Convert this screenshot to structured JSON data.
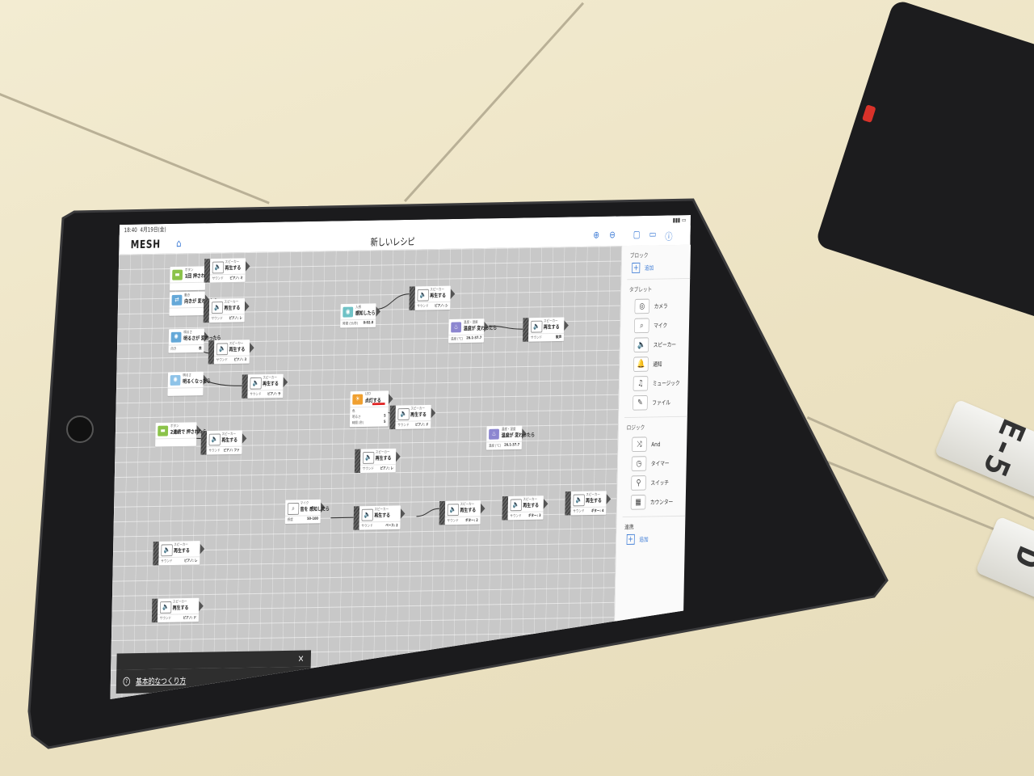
{
  "status": {
    "time": "18:40",
    "date": "4月19日(金)"
  },
  "nav": {
    "logo": "MESH",
    "title": "新しいレシピ"
  },
  "sidebar": {
    "block_title": "ブロック",
    "add_label": "追加",
    "tablet_title": "タブレット",
    "tablet_items": [
      {
        "label": "カメラ",
        "icon": "camera-icon",
        "glyph": "◎"
      },
      {
        "label": "マイク",
        "icon": "microphone-icon",
        "glyph": "⌕"
      },
      {
        "label": "スピーカー",
        "icon": "speaker-icon",
        "glyph": "🔈"
      },
      {
        "label": "通知",
        "icon": "bell-icon",
        "glyph": "🔔"
      },
      {
        "label": "ミュージック",
        "icon": "music-icon",
        "glyph": "♫"
      },
      {
        "label": "ファイル",
        "icon": "file-icon",
        "glyph": "✎"
      }
    ],
    "logic_title": "ロジック",
    "logic_items": [
      {
        "label": "And",
        "icon": "and-icon",
        "glyph": "⤨"
      },
      {
        "label": "タイマー",
        "icon": "timer-icon",
        "glyph": "◷"
      },
      {
        "label": "スイッチ",
        "icon": "switch-icon",
        "glyph": "⚲"
      },
      {
        "label": "カウンター",
        "icon": "counter-icon",
        "glyph": "▦"
      }
    ],
    "outer_title": "連携",
    "outer_add_label": "追加"
  },
  "blocks": [
    {
      "id": "b1",
      "kind": "ボタン",
      "action": "1回\n押されたら",
      "p1": "",
      "p2": "",
      "color": "green",
      "glyph": "▬"
    },
    {
      "id": "b2",
      "kind": "スピーカー",
      "action": "再生する",
      "p1": "サウンド",
      "p2": "ピアノ: ミ",
      "color": "spk",
      "glyph": "🔈"
    },
    {
      "id": "b3",
      "kind": "動き",
      "action": "向きが\n変わったら",
      "p1": "",
      "p2": "",
      "color": "blue",
      "glyph": "⇄"
    },
    {
      "id": "b4",
      "kind": "スピーカー",
      "action": "再生する",
      "p1": "サウンド",
      "p2": "ピアノ: レ",
      "color": "spk",
      "glyph": "🔈"
    },
    {
      "id": "b5",
      "kind": "明るさ",
      "action": "明るさが\n変わったら",
      "p1": "向き",
      "p2": "表",
      "color": "blue",
      "glyph": "✺"
    },
    {
      "id": "b6",
      "kind": "スピーカー",
      "action": "再生する",
      "p1": "サウンド",
      "p2": "ピアノ: ミ",
      "color": "spk",
      "glyph": "🔈"
    },
    {
      "id": "b7",
      "kind": "明るさ",
      "action": "明るくなったら",
      "p1": "",
      "p2": "",
      "color": "lblue",
      "glyph": "✺"
    },
    {
      "id": "b8",
      "kind": "スピーカー",
      "action": "再生する",
      "p1": "サウンド",
      "p2": "ピアノ: ラ",
      "color": "spk",
      "glyph": "🔈"
    },
    {
      "id": "b9",
      "kind": "ボタン",
      "action": "2連続で\n押されたら",
      "p1": "",
      "p2": "",
      "color": "green",
      "glyph": "▬"
    },
    {
      "id": "b10",
      "kind": "スピーカー",
      "action": "再生する",
      "p1": "サウンド",
      "p2": "ピアノ: ファ",
      "color": "spk",
      "glyph": "🔈"
    },
    {
      "id": "b11",
      "kind": "人感",
      "action": "感知したら",
      "p1": "時間 (分/秒)",
      "p2": "0:02.0",
      "color": "teal",
      "glyph": "◉"
    },
    {
      "id": "b12",
      "kind": "スピーカー",
      "action": "再生する",
      "p1": "サウンド",
      "p2": "ピアノ: シ",
      "color": "spk",
      "glyph": "🔈"
    },
    {
      "id": "b13",
      "kind": "温度・湿度",
      "action": "温度が\n変わったら",
      "p1": "温度 (°C)",
      "p2": "26.1-37.7",
      "color": "purple",
      "glyph": "♨"
    },
    {
      "id": "b14",
      "kind": "スピーカー",
      "action": "再生する",
      "p1": "サウンド",
      "p2": "歓声",
      "color": "spk",
      "glyph": "🔈"
    },
    {
      "id": "b15",
      "kind": "LED",
      "action": "点灯する",
      "p1": "色",
      "p2": "",
      "color": "orange",
      "glyph": "☀"
    },
    {
      "id": "b16",
      "kind": "スピーカー",
      "action": "再生する",
      "p1": "サウンド",
      "p2": "ピアノ: ド",
      "color": "spk",
      "glyph": "🔈"
    },
    {
      "id": "b17",
      "kind": "温度・湿度",
      "action": "温度が\n変わったら",
      "p1": "温度 (°C)",
      "p2": "26.1-37.7",
      "color": "purple",
      "glyph": "♨"
    },
    {
      "id": "b18",
      "kind": "スピーカー",
      "action": "再生する",
      "p1": "サウンド",
      "p2": "ピアノ: レ",
      "color": "spk",
      "glyph": "🔈"
    },
    {
      "id": "b19",
      "kind": "マイク",
      "action": "音を\n感知したら",
      "p1": "感度",
      "p2": "50-100",
      "color": "spk",
      "glyph": "⌕"
    },
    {
      "id": "b20",
      "kind": "スピーカー",
      "action": "再生する",
      "p1": "サウンド",
      "p2": "ベース: 2",
      "color": "spk",
      "glyph": "🔈"
    },
    {
      "id": "b21",
      "kind": "スピーカー",
      "action": "再生する",
      "p1": "サウンド",
      "p2": "ギター: 2",
      "color": "spk",
      "glyph": "🔈"
    },
    {
      "id": "b22",
      "kind": "スピーカー",
      "action": "再生する",
      "p1": "サウンド",
      "p2": "ギター: 3",
      "color": "spk",
      "glyph": "🔈"
    },
    {
      "id": "b23",
      "kind": "スピーカー",
      "action": "再生する",
      "p1": "サウンド",
      "p2": "ギター: 4",
      "color": "spk",
      "glyph": "🔈"
    },
    {
      "id": "b24",
      "kind": "スピーカー",
      "action": "再生する",
      "p1": "サウンド",
      "p2": "ギター: 5",
      "color": "spk",
      "glyph": "🔈"
    },
    {
      "id": "b25",
      "kind": "スピーカー",
      "action": "再生する",
      "p1": "サウンド",
      "p2": "ピアノ: レ",
      "color": "spk",
      "glyph": "🔈"
    },
    {
      "id": "b26",
      "kind": "スピーカー",
      "action": "再生する",
      "p1": "サウンド",
      "p2": "ピアノ: ド",
      "color": "spk",
      "glyph": "🔈"
    }
  ],
  "led_extra": {
    "p3": "明るさ",
    "p3v": "5",
    "p4": "時間 (秒)",
    "p4v": "5",
    "bar_color": "#e02020"
  },
  "tip": {
    "text": "基本的なつくり方",
    "close": "×",
    "icon": "?"
  },
  "labels": {
    "e5": "E-5",
    "d": "D"
  }
}
